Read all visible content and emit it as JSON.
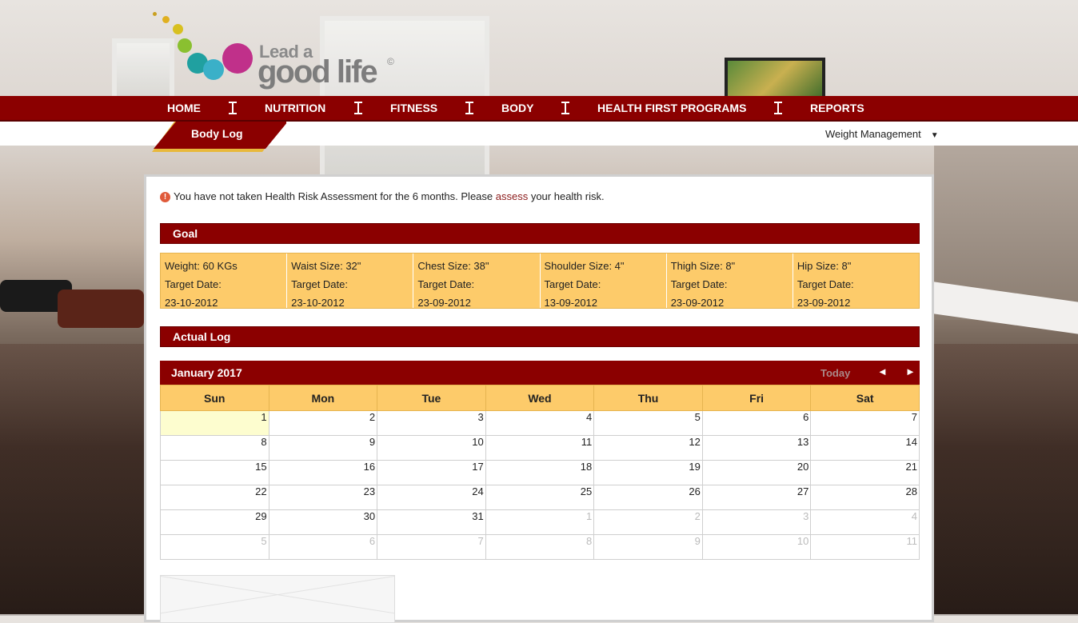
{
  "logo": {
    "line1": "Lead a",
    "line2": "good life",
    "copyright": "©"
  },
  "nav": {
    "items": [
      {
        "label": "HOME"
      },
      {
        "label": "NUTRITION"
      },
      {
        "label": "FITNESS"
      },
      {
        "label": "BODY"
      },
      {
        "label": "HEALTH FIRST PROGRAMS"
      },
      {
        "label": "REPORTS"
      }
    ]
  },
  "subnav": {
    "active_tab": "Body Log",
    "dropdown_label": "Weight Management",
    "dropdown_caret": "▼"
  },
  "alert": {
    "icon": "!",
    "text_before": "You have not taken Health Risk Assessment for the 6 months. Please ",
    "link": "assess",
    "text_after": " your health risk."
  },
  "goal": {
    "heading": "Goal",
    "items": [
      {
        "measure": "Weight: 60 KGs",
        "date_label": "Target Date:",
        "date": "23-10-2012"
      },
      {
        "measure": "Waist Size: 32\"",
        "date_label": "Target Date:",
        "date": "23-10-2012"
      },
      {
        "measure": "Chest Size: 38\"",
        "date_label": "Target Date:",
        "date": "23-09-2012"
      },
      {
        "measure": "Shoulder Size: 4\"",
        "date_label": "Target Date:",
        "date": "13-09-2012"
      },
      {
        "measure": "Thigh Size: 8\"",
        "date_label": "Target Date:",
        "date": "23-09-2012"
      },
      {
        "measure": "Hip Size: 8\"",
        "date_label": "Target Date:",
        "date": "23-09-2012"
      }
    ]
  },
  "actual_log": {
    "heading": "Actual Log"
  },
  "calendar": {
    "title": "January 2017",
    "today_label": "Today",
    "prev": "◄",
    "next": "►",
    "weekdays": [
      "Sun",
      "Mon",
      "Tue",
      "Wed",
      "Thu",
      "Fri",
      "Sat"
    ],
    "weeks": [
      [
        {
          "d": "1",
          "other": false,
          "today": true
        },
        {
          "d": "2",
          "other": false
        },
        {
          "d": "3",
          "other": false
        },
        {
          "d": "4",
          "other": false
        },
        {
          "d": "5",
          "other": false
        },
        {
          "d": "6",
          "other": false
        },
        {
          "d": "7",
          "other": false
        }
      ],
      [
        {
          "d": "8",
          "other": false
        },
        {
          "d": "9",
          "other": false
        },
        {
          "d": "10",
          "other": false
        },
        {
          "d": "11",
          "other": false
        },
        {
          "d": "12",
          "other": false
        },
        {
          "d": "13",
          "other": false
        },
        {
          "d": "14",
          "other": false
        }
      ],
      [
        {
          "d": "15",
          "other": false
        },
        {
          "d": "16",
          "other": false
        },
        {
          "d": "17",
          "other": false
        },
        {
          "d": "18",
          "other": false
        },
        {
          "d": "19",
          "other": false
        },
        {
          "d": "20",
          "other": false
        },
        {
          "d": "21",
          "other": false
        }
      ],
      [
        {
          "d": "22",
          "other": false
        },
        {
          "d": "23",
          "other": false
        },
        {
          "d": "24",
          "other": false
        },
        {
          "d": "25",
          "other": false
        },
        {
          "d": "26",
          "other": false
        },
        {
          "d": "27",
          "other": false
        },
        {
          "d": "28",
          "other": false
        }
      ],
      [
        {
          "d": "29",
          "other": false
        },
        {
          "d": "30",
          "other": false
        },
        {
          "d": "31",
          "other": false
        },
        {
          "d": "1",
          "other": true
        },
        {
          "d": "2",
          "other": true
        },
        {
          "d": "3",
          "other": true
        },
        {
          "d": "4",
          "other": true
        }
      ],
      [
        {
          "d": "5",
          "other": true
        },
        {
          "d": "6",
          "other": true
        },
        {
          "d": "7",
          "other": true
        },
        {
          "d": "8",
          "other": true
        },
        {
          "d": "9",
          "other": true
        },
        {
          "d": "10",
          "other": true
        },
        {
          "d": "11",
          "other": true
        }
      ]
    ]
  },
  "colors": {
    "brand_red": "#8b0000",
    "goal_yellow": "#fdcb6a",
    "today_highlight": "#fdfdcf"
  }
}
